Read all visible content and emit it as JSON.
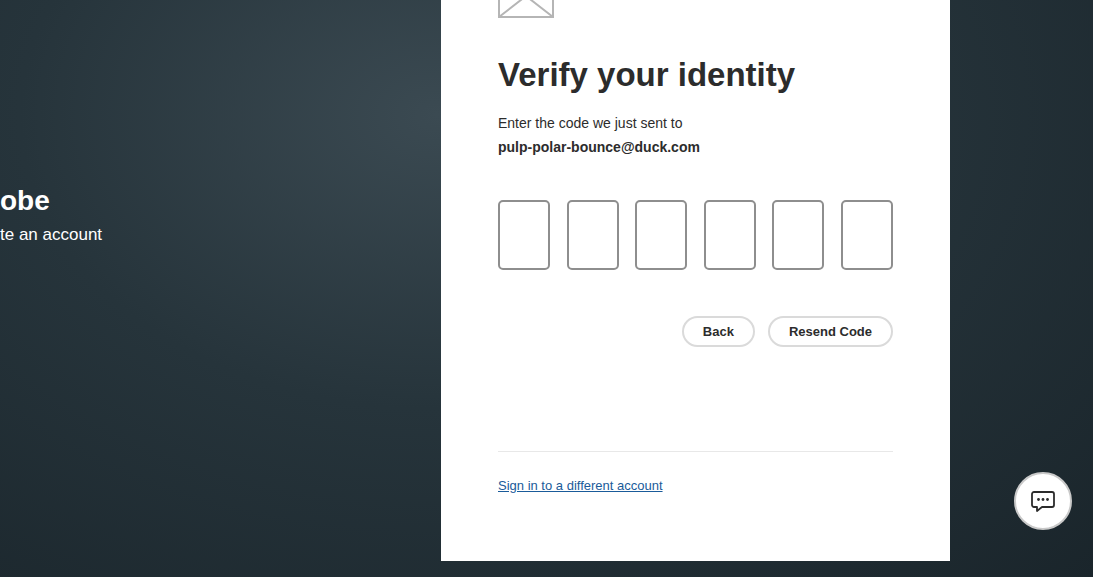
{
  "brand": {
    "title": "obe",
    "subtitle": "te an account"
  },
  "card": {
    "title": "Verify your identity",
    "prompt": "Enter the code we just sent to",
    "email": "pulp-polar-bounce@duck.com"
  },
  "code_inputs": [
    {
      "value": ""
    },
    {
      "value": ""
    },
    {
      "value": ""
    },
    {
      "value": ""
    },
    {
      "value": ""
    },
    {
      "value": ""
    }
  ],
  "buttons": [
    "Back",
    "Resend Code"
  ],
  "link": "Sign in to a different account"
}
